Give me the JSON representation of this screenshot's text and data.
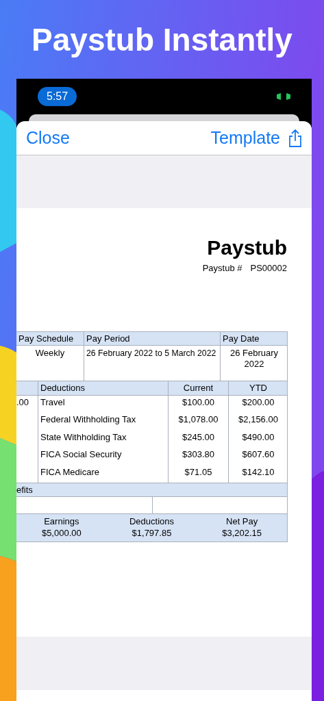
{
  "headline": "Paystub Instantly",
  "status_bar": {
    "time": "5:57"
  },
  "nav": {
    "close": "Close",
    "template": "Template"
  },
  "document": {
    "title": "Paystub",
    "number_label": "Paystub #",
    "number": "PS00002",
    "schedule_table": {
      "columns": [
        "Pay Schedule",
        "Pay Period",
        "Pay Date"
      ],
      "row": [
        "Weekly",
        "26 February 2022 to 5 March 2022",
        "26 February 2022"
      ]
    },
    "deductions_table": {
      "columns": [
        "Deductions",
        "Current",
        "YTD"
      ],
      "rows": [
        {
          "column_1": ".00",
          "name": "Travel",
          "current": "$100.00",
          "ytd": "$200.00"
        },
        {
          "name": "Federal Withholding Tax",
          "current": "$1,078.00",
          "ytd": "$2,156.00"
        },
        {
          "name": "State Withholding Tax",
          "current": "$245.00",
          "ytd": "$490.00"
        },
        {
          "name": "FICA Social Security",
          "current": "$303.80",
          "ytd": "$607.60"
        },
        {
          "name": "FICA Medicare",
          "current": "$71.05",
          "ytd": "$142.10"
        }
      ]
    },
    "benefits_header": "efits",
    "summary": [
      {
        "label": "Earnings",
        "value": "$5,000.00"
      },
      {
        "label": "Deductions",
        "value": "$1,797.85"
      },
      {
        "label": "Net Pay",
        "value": "$3,202.15"
      }
    ]
  }
}
